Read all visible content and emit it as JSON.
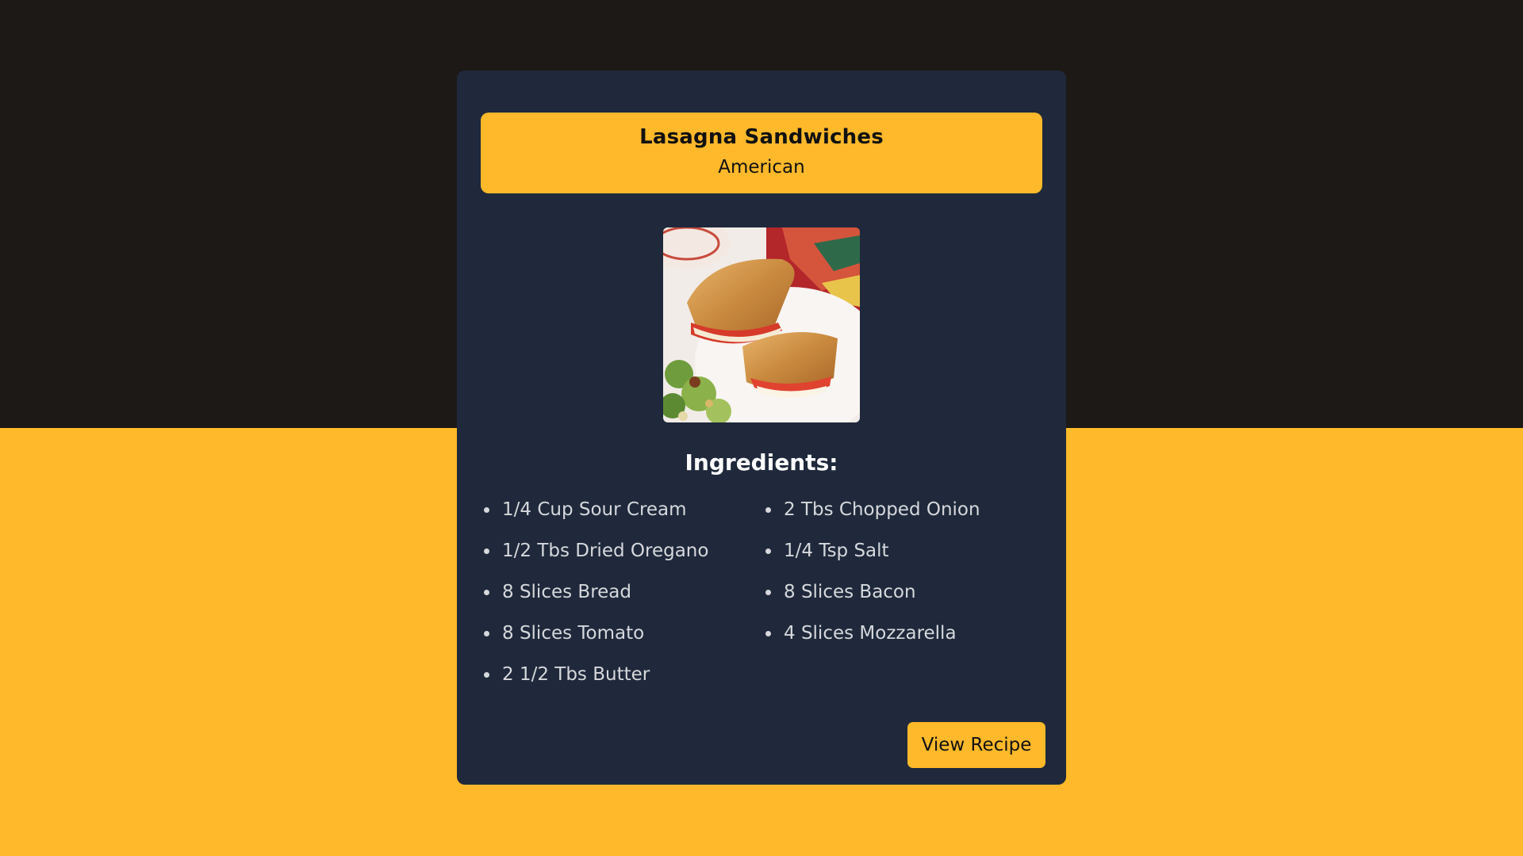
{
  "theme": {
    "background_dark": "#1d1916",
    "background_accent": "#ffb92a",
    "card": "#1f293b",
    "accent": "#ffb92a"
  },
  "recipe": {
    "title": "Lasagna Sandwiches",
    "cuisine": "American",
    "photo": "grilled-sandwich-photo",
    "ingredients_heading": "Ingredients:",
    "ingredients_left": [
      "1/4 Cup Sour Cream",
      "1/2 Tbs Dried Oregano",
      "8 Slices Bread",
      "8 Slices Tomato",
      "2 1/2 Tbs Butter"
    ],
    "ingredients_right": [
      "2 Tbs Chopped Onion",
      "1/4 Tsp Salt",
      "8 Slices Bacon",
      "4 Slices Mozzarella"
    ],
    "view_button": "View Recipe"
  }
}
